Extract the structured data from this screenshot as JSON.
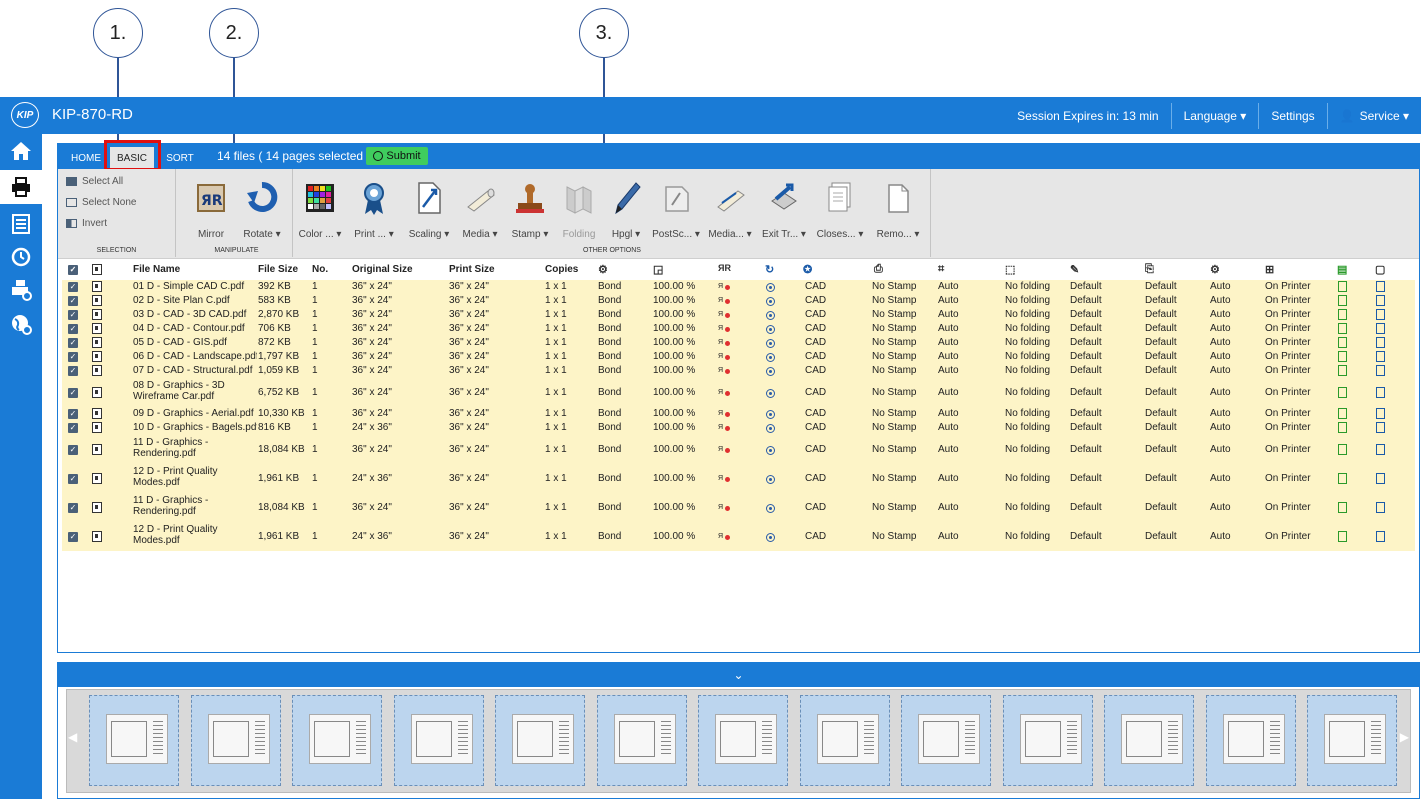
{
  "callouts": [
    "1.",
    "2.",
    "3."
  ],
  "app": {
    "logo": "KIP",
    "title": "KIP-870-RD"
  },
  "topbar": {
    "session": "Session Expires in: 13 min",
    "language": "Language ▾",
    "settings": "Settings",
    "user": "Service ▾"
  },
  "nav": [
    "home-icon",
    "printer-icon",
    "queue-list-icon",
    "history-clock-icon",
    "scan-printer-icon",
    "globe-settings-icon"
  ],
  "tabs": {
    "home": "HOME",
    "basic": "BASIC",
    "sort": "SORT"
  },
  "files_info": "14 files ( 14 pages selected )",
  "submit": "Submit",
  "ribbon": {
    "selection": {
      "label": "SELECTION",
      "items": [
        "Select All",
        "Select None",
        "Invert"
      ]
    },
    "manipulate": {
      "label": "MANIPULATE",
      "items": [
        "Mirror",
        "Rotate ▾"
      ]
    },
    "other": {
      "label": "OTHER OPTIONS",
      "items": [
        "Color ... ▾",
        "Print ... ▾",
        "Scaling ▾",
        "Media ▾",
        "Stamp ▾",
        "Folding",
        "Hpgl ▾",
        "PostSc... ▾",
        "Media... ▾",
        "Exit Tr... ▾",
        "Closes... ▾",
        "Remo... ▾"
      ]
    }
  },
  "table": {
    "headers": [
      "File Name",
      "File Size",
      "No.",
      "Original Size",
      "Print Size",
      "Copies"
    ],
    "rows": [
      {
        "name": "01 D - Simple CAD C.pdf",
        "size": "392 KB",
        "no": "1",
        "orig": "36\" x 24\"",
        "print": "36\" x 24\"",
        "copies": "1 x 1",
        "media": "Bond",
        "scale": "100.00 %",
        "mode": "CAD",
        "stamp": "No Stamp",
        "auto1": "Auto",
        "fold": "No folding",
        "def1": "Default",
        "def2": "Default",
        "auto2": "Auto",
        "printer": "On Printer"
      },
      {
        "name": "02 D - Site Plan C.pdf",
        "size": "583 KB",
        "no": "1",
        "orig": "36\" x 24\"",
        "print": "36\" x 24\"",
        "copies": "1 x 1",
        "media": "Bond",
        "scale": "100.00 %",
        "mode": "CAD",
        "stamp": "No Stamp",
        "auto1": "Auto",
        "fold": "No folding",
        "def1": "Default",
        "def2": "Default",
        "auto2": "Auto",
        "printer": "On Printer"
      },
      {
        "name": "03 D - CAD - 3D CAD.pdf",
        "size": "2,870 KB",
        "no": "1",
        "orig": "36\" x 24\"",
        "print": "36\" x 24\"",
        "copies": "1 x 1",
        "media": "Bond",
        "scale": "100.00 %",
        "mode": "CAD",
        "stamp": "No Stamp",
        "auto1": "Auto",
        "fold": "No folding",
        "def1": "Default",
        "def2": "Default",
        "auto2": "Auto",
        "printer": "On Printer"
      },
      {
        "name": "04 D - CAD - Contour.pdf",
        "size": "706 KB",
        "no": "1",
        "orig": "36\" x 24\"",
        "print": "36\" x 24\"",
        "copies": "1 x 1",
        "media": "Bond",
        "scale": "100.00 %",
        "mode": "CAD",
        "stamp": "No Stamp",
        "auto1": "Auto",
        "fold": "No folding",
        "def1": "Default",
        "def2": "Default",
        "auto2": "Auto",
        "printer": "On Printer"
      },
      {
        "name": "05 D - CAD - GIS.pdf",
        "size": "872 KB",
        "no": "1",
        "orig": "36\" x 24\"",
        "print": "36\" x 24\"",
        "copies": "1 x 1",
        "media": "Bond",
        "scale": "100.00 %",
        "mode": "CAD",
        "stamp": "No Stamp",
        "auto1": "Auto",
        "fold": "No folding",
        "def1": "Default",
        "def2": "Default",
        "auto2": "Auto",
        "printer": "On Printer"
      },
      {
        "name": "06 D - CAD - Landscape.pdf",
        "size": "1,797 KB",
        "no": "1",
        "orig": "36\" x 24\"",
        "print": "36\" x 24\"",
        "copies": "1 x 1",
        "media": "Bond",
        "scale": "100.00 %",
        "mode": "CAD",
        "stamp": "No Stamp",
        "auto1": "Auto",
        "fold": "No folding",
        "def1": "Default",
        "def2": "Default",
        "auto2": "Auto",
        "printer": "On Printer"
      },
      {
        "name": "07 D - CAD - Structural.pdf",
        "size": "1,059 KB",
        "no": "1",
        "orig": "36\" x 24\"",
        "print": "36\" x 24\"",
        "copies": "1 x 1",
        "media": "Bond",
        "scale": "100.00 %",
        "mode": "CAD",
        "stamp": "No Stamp",
        "auto1": "Auto",
        "fold": "No folding",
        "def1": "Default",
        "def2": "Default",
        "auto2": "Auto",
        "printer": "On Printer"
      },
      {
        "name": "08 D - Graphics - 3D Wireframe Car.pdf",
        "size": "6,752 KB",
        "no": "1",
        "orig": "36\" x 24\"",
        "print": "36\" x 24\"",
        "copies": "1 x 1",
        "media": "Bond",
        "scale": "100.00 %",
        "mode": "CAD",
        "stamp": "No Stamp",
        "auto1": "Auto",
        "fold": "No folding",
        "def1": "Default",
        "def2": "Default",
        "auto2": "Auto",
        "printer": "On Printer"
      },
      {
        "name": "09 D - Graphics - Aerial.pdf",
        "size": "10,330 KB",
        "no": "1",
        "orig": "36\" x 24\"",
        "print": "36\" x 24\"",
        "copies": "1 x 1",
        "media": "Bond",
        "scale": "100.00 %",
        "mode": "CAD",
        "stamp": "No Stamp",
        "auto1": "Auto",
        "fold": "No folding",
        "def1": "Default",
        "def2": "Default",
        "auto2": "Auto",
        "printer": "On Printer"
      },
      {
        "name": "10 D - Graphics - Bagels.pdf",
        "size": "816 KB",
        "no": "1",
        "orig": "24\" x 36\"",
        "print": "36\" x 24\"",
        "copies": "1 x 1",
        "media": "Bond",
        "scale": "100.00 %",
        "mode": "CAD",
        "stamp": "No Stamp",
        "auto1": "Auto",
        "fold": "No folding",
        "def1": "Default",
        "def2": "Default",
        "auto2": "Auto",
        "printer": "On Printer"
      },
      {
        "name": "11 D - Graphics - Rendering.pdf",
        "size": "18,084 KB",
        "no": "1",
        "orig": "36\" x 24\"",
        "print": "36\" x 24\"",
        "copies": "1 x 1",
        "media": "Bond",
        "scale": "100.00 %",
        "mode": "CAD",
        "stamp": "No Stamp",
        "auto1": "Auto",
        "fold": "No folding",
        "def1": "Default",
        "def2": "Default",
        "auto2": "Auto",
        "printer": "On Printer"
      },
      {
        "name": "12 D - Print Quality Modes.pdf",
        "size": "1,961 KB",
        "no": "1",
        "orig": "24\" x 36\"",
        "print": "36\" x 24\"",
        "copies": "1 x 1",
        "media": "Bond",
        "scale": "100.00 %",
        "mode": "CAD",
        "stamp": "No Stamp",
        "auto1": "Auto",
        "fold": "No folding",
        "def1": "Default",
        "def2": "Default",
        "auto2": "Auto",
        "printer": "On Printer"
      },
      {
        "name": "11 D - Graphics - Rendering.pdf",
        "size": "18,084 KB",
        "no": "1",
        "orig": "36\" x 24\"",
        "print": "36\" x 24\"",
        "copies": "1 x 1",
        "media": "Bond",
        "scale": "100.00 %",
        "mode": "CAD",
        "stamp": "No Stamp",
        "auto1": "Auto",
        "fold": "No folding",
        "def1": "Default",
        "def2": "Default",
        "auto2": "Auto",
        "printer": "On Printer"
      },
      {
        "name": "12 D - Print Quality Modes.pdf",
        "size": "1,961 KB",
        "no": "1",
        "orig": "24\" x 36\"",
        "print": "36\" x 24\"",
        "copies": "1 x 1",
        "media": "Bond",
        "scale": "100.00 %",
        "mode": "CAD",
        "stamp": "No Stamp",
        "auto1": "Auto",
        "fold": "No folding",
        "def1": "Default",
        "def2": "Default",
        "auto2": "Auto",
        "printer": "On Printer"
      }
    ]
  },
  "strip": {
    "toggle": "⌄",
    "left_arrow": "◀",
    "right_arrow": "▶",
    "thumbnail_count": 13
  },
  "colors": {
    "brand_blue": "#1a7bd6",
    "row_yellow": "#fdf4c7",
    "submit_green": "#3fcc5e",
    "highlight_red": "#e01010"
  }
}
